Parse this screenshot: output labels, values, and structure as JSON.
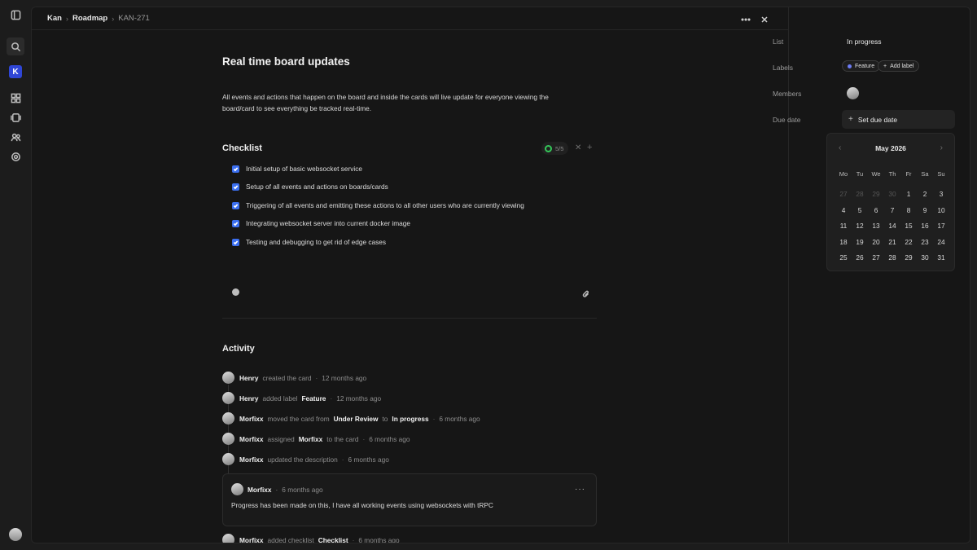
{
  "rail": {
    "workspace_initial": "K",
    "items": [
      "toggle-sidebar-icon",
      "search-icon",
      "dashboard-icon",
      "boards-icon",
      "members-icon",
      "settings-icon"
    ]
  },
  "breadcrumb": [
    "Kan",
    "Roadmap",
    "KAN-271"
  ],
  "card": {
    "title": "Real time board updates",
    "description": "All events and actions that happen on the board and inside the cards will live update for everyone viewing the board/card to see everything be tracked real-time."
  },
  "checklist": {
    "title": "Checklist",
    "progress": "5/5",
    "items": [
      {
        "text": "Initial setup of basic websocket service",
        "checked": true
      },
      {
        "text": "Setup of all events and actions on boards/cards",
        "checked": true
      },
      {
        "text": "Triggering of all events and emitting these actions to all other users who are currently viewing",
        "checked": true
      },
      {
        "text": "Integrating websocket server into current docker image",
        "checked": true
      },
      {
        "text": "Testing and debugging to get rid of edge cases",
        "checked": true
      }
    ]
  },
  "activity": {
    "title": "Activity",
    "entries": [
      {
        "user": "Henry",
        "p1": "created the card",
        "time": "12 months ago"
      },
      {
        "user": "Henry",
        "p1": "added label",
        "b1": "Feature",
        "time": "12 months ago"
      },
      {
        "user": "Morfixx",
        "p1": "moved the card from",
        "b1": "Under Review",
        "p2": "to",
        "b2": "In progress",
        "time": "6 months ago"
      },
      {
        "user": "Morfixx",
        "p1": "assigned",
        "b1": "Morfixx",
        "p2": "to the card",
        "time": "6 months ago"
      },
      {
        "user": "Morfixx",
        "p1": "updated the description",
        "time": "6 months ago"
      }
    ],
    "comment": {
      "user": "Morfixx",
      "time": "6 months ago",
      "text": "Progress has been made on this, I have all working events using websockets with tRPC"
    },
    "last": {
      "user": "Morfixx",
      "p1": "added checklist",
      "b1": "Checklist",
      "time": "6 months ago"
    }
  },
  "sidebar": {
    "list_label": "List",
    "list_value": "In progress",
    "labels_label": "Labels",
    "label_chip": "Feature",
    "add_label": "Add label",
    "members_label": "Members",
    "due_label": "Due date",
    "due_button": "Set due date"
  },
  "calendar": {
    "month": "May 2026",
    "dow": [
      "Mo",
      "Tu",
      "We",
      "Th",
      "Fr",
      "Sa",
      "Su"
    ],
    "days": [
      {
        "d": "27",
        "m": true
      },
      {
        "d": "28",
        "m": true
      },
      {
        "d": "29",
        "m": true
      },
      {
        "d": "30",
        "m": true
      },
      {
        "d": "1"
      },
      {
        "d": "2"
      },
      {
        "d": "3"
      },
      {
        "d": "4"
      },
      {
        "d": "5"
      },
      {
        "d": "6"
      },
      {
        "d": "7"
      },
      {
        "d": "8"
      },
      {
        "d": "9"
      },
      {
        "d": "10"
      },
      {
        "d": "11"
      },
      {
        "d": "12"
      },
      {
        "d": "13"
      },
      {
        "d": "14"
      },
      {
        "d": "15"
      },
      {
        "d": "16"
      },
      {
        "d": "17"
      },
      {
        "d": "18"
      },
      {
        "d": "19"
      },
      {
        "d": "20"
      },
      {
        "d": "21"
      },
      {
        "d": "22"
      },
      {
        "d": "23"
      },
      {
        "d": "24"
      },
      {
        "d": "25"
      },
      {
        "d": "26"
      },
      {
        "d": "27"
      },
      {
        "d": "28"
      },
      {
        "d": "29"
      },
      {
        "d": "30"
      },
      {
        "d": "31"
      }
    ]
  },
  "colors": {
    "accent": "#3b6ff0",
    "workspace": "#2f46d6",
    "progress_ring": "#34c759",
    "label_dot": "#6d7cf5"
  }
}
